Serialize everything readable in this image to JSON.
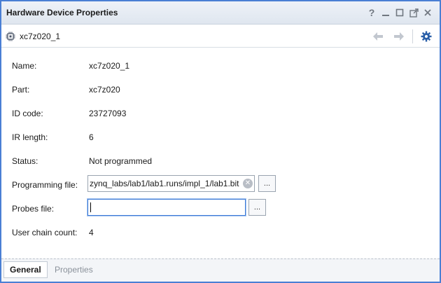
{
  "window": {
    "title": "Hardware Device Properties",
    "controls": [
      "?",
      "minimize",
      "restore",
      "float",
      "close"
    ]
  },
  "toolbar": {
    "device_name": "xc7z020_1",
    "device_icon": "chip-icon",
    "back_icon": "arrow-left-icon",
    "forward_icon": "arrow-right-icon",
    "settings_icon": "gear-icon"
  },
  "properties": {
    "name": {
      "label": "Name:",
      "value": "xc7z020_1"
    },
    "part": {
      "label": "Part:",
      "value": "xc7z020"
    },
    "id_code": {
      "label": "ID code:",
      "value": "23727093"
    },
    "ir_length": {
      "label": "IR length:",
      "value": "6"
    },
    "status": {
      "label": "Status:",
      "value": "Not programmed"
    },
    "programming_file": {
      "label": "Programming file:",
      "value": "zynq_labs/lab1/lab1.runs/impl_1/lab1.bit",
      "browse": "..."
    },
    "probes_file": {
      "label": "Probes file:",
      "value": "",
      "browse": "..."
    },
    "user_chain_count": {
      "label": "User chain count:",
      "value": "4"
    }
  },
  "tabs": [
    {
      "label": "General",
      "active": true
    },
    {
      "label": "Properties",
      "active": false
    }
  ],
  "colors": {
    "accent": "#4a7fd4",
    "settings_icon": "#2a5fa8"
  }
}
